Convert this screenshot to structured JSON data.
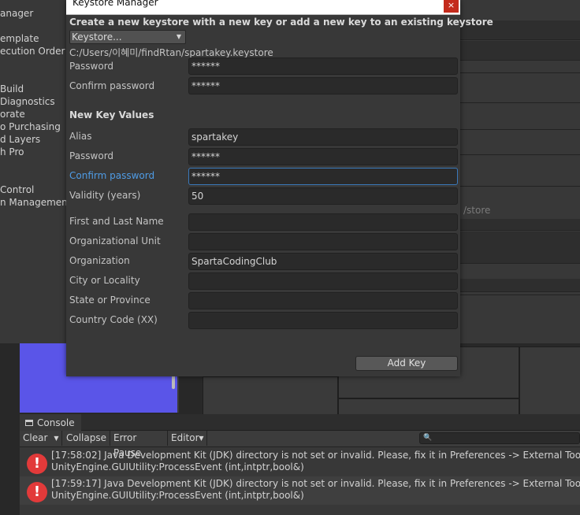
{
  "project_settings_sidebar": {
    "items": [
      {
        "label": "anager"
      },
      {
        "label": "emplate"
      },
      {
        "label": "ecution Order"
      },
      {
        "label": "Build"
      },
      {
        "label": "Diagnostics"
      },
      {
        "label": "orate"
      },
      {
        "label": "o Purchasing"
      },
      {
        "label": "d Layers"
      },
      {
        "label": "h Pro"
      },
      {
        "label": "Control"
      },
      {
        "label": "n Management"
      }
    ]
  },
  "right_panel": {
    "fragment_text": "/store"
  },
  "dialog": {
    "title": "Keystore Manager",
    "close_glyph": "×",
    "header": "Create a new keystore with a new key or add a new key to an existing keystore",
    "keystore_dropdown": {
      "value": "Keystore...",
      "caret": "▼"
    },
    "keystore_path": "C:/Users/이혜미/findRtan/spartakey.keystore",
    "keystore_fields": [
      {
        "label": "Password",
        "value": "******"
      },
      {
        "label": "Confirm password",
        "value": "******"
      }
    ],
    "new_key_title": "New Key Values",
    "key_fields": [
      {
        "label": "Alias",
        "value": "spartakey"
      },
      {
        "label": "Password",
        "value": "******"
      },
      {
        "label": "Confirm password",
        "value": "******",
        "focused": true
      },
      {
        "label": "Validity (years)",
        "value": "50"
      }
    ],
    "identity_fields": [
      {
        "label": "First and Last Name",
        "value": ""
      },
      {
        "label": "Organizational Unit",
        "value": ""
      },
      {
        "label": "Organization",
        "value": "SpartaCodingClub"
      },
      {
        "label": "City or Locality",
        "value": ""
      },
      {
        "label": "State or Province",
        "value": ""
      },
      {
        "label": "Country Code (XX)",
        "value": ""
      }
    ],
    "add_key_label": "Add Key"
  },
  "console": {
    "tab_label": "Console",
    "toolbar": {
      "clear": "Clear",
      "clear_caret": "▼",
      "collapse": "Collapse",
      "error_pause": "Error Pause",
      "editor": "Editor",
      "editor_caret": "▼",
      "search_glyph": "🔍"
    },
    "logs": [
      {
        "line1": "[17:58:02] Java Development Kit (JDK) directory is not set or invalid. Please, fix it in Preferences -> External Tools",
        "line2": "UnityEngine.GUIUtility:ProcessEvent (int,intptr,bool&)"
      },
      {
        "line1": "[17:59:17] Java Development Kit (JDK) directory is not set or invalid. Please, fix it in Preferences -> External Tools",
        "line2": "UnityEngine.GUIUtility:ProcessEvent (int,intptr,bool&)"
      }
    ],
    "error_glyph": "!"
  },
  "colors": {
    "accent_blue": "#4f9ce6",
    "error_red": "#e23a3a",
    "scene_blue": "#5a55e8",
    "close_red": "#c42b1c"
  }
}
